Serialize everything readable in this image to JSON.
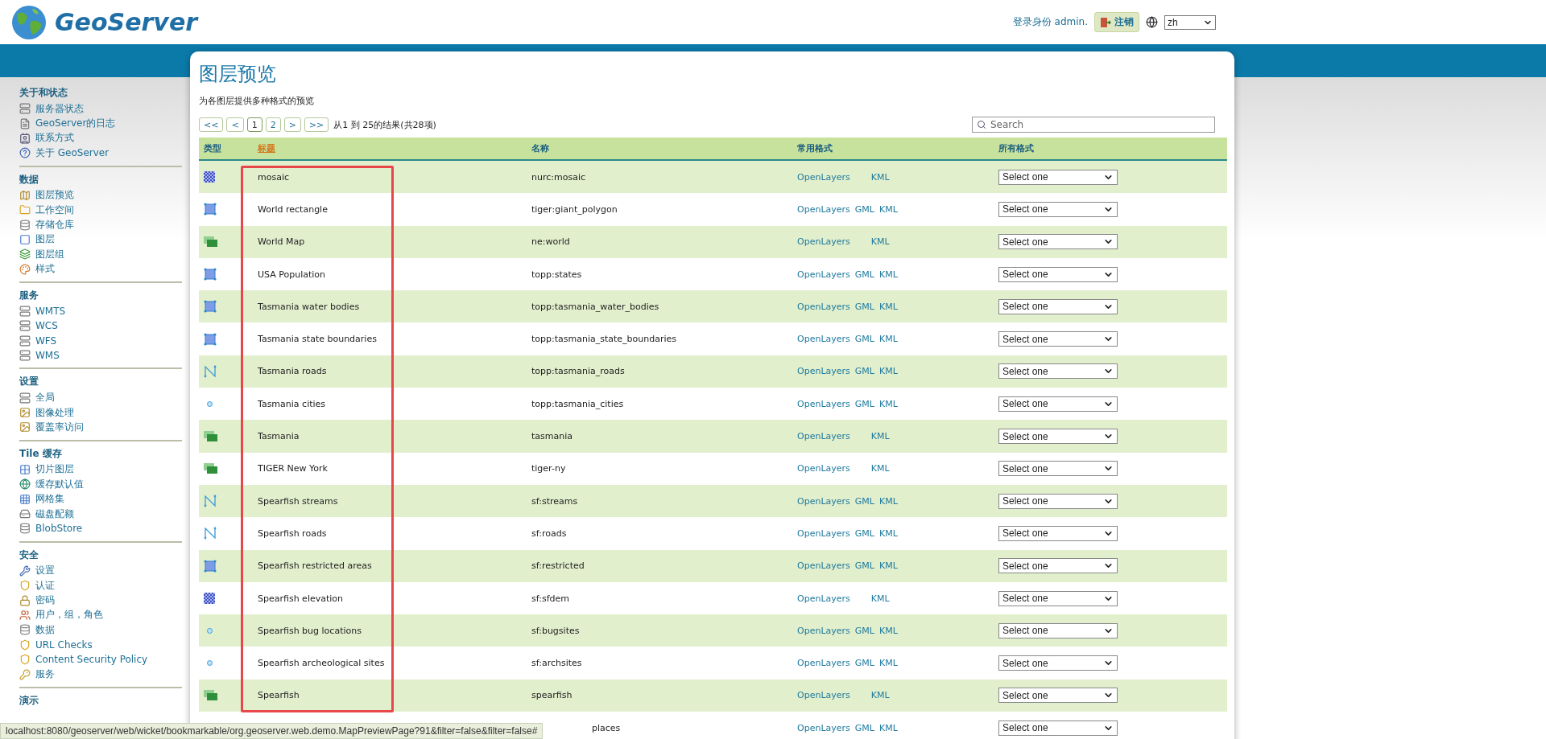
{
  "header": {
    "logo_text": "GeoServer",
    "login_text": "登录身份 admin.",
    "logout_button": "注销",
    "language": "zh"
  },
  "sidebar": [
    {
      "title": "关于和状态",
      "items": [
        "服务器状态",
        "GeoServer的日志",
        "联系方式",
        "关于 GeoServer"
      ]
    },
    {
      "title": "数据",
      "items": [
        "图层预览",
        "工作空间",
        "存储仓库",
        "图层",
        "图层组",
        "样式"
      ]
    },
    {
      "title": "服务",
      "items": [
        "WMTS",
        "WCS",
        "WFS",
        "WMS"
      ]
    },
    {
      "title": "设置",
      "items": [
        "全局",
        "图像处理",
        "覆盖率访问"
      ]
    },
    {
      "title": "Tile 缓存",
      "items": [
        "切片图层",
        "缓存默认值",
        "网格集",
        "磁盘配额",
        "BlobStore"
      ]
    },
    {
      "title": "安全",
      "items": [
        "设置",
        "认证",
        "密码",
        "用户，组，角色",
        "数据",
        "URL Checks",
        "Content Security Policy",
        "服务"
      ]
    },
    {
      "title": "演示"
    }
  ],
  "page": {
    "title": "图层预览",
    "description": "为各图层提供多种格式的预览"
  },
  "pager": {
    "buttons": [
      {
        "label": "<<",
        "selected": false
      },
      {
        "label": "<",
        "selected": false
      },
      {
        "label": "1",
        "selected": true
      },
      {
        "label": "2",
        "selected": false
      },
      {
        "label": ">",
        "selected": false
      },
      {
        "label": ">>",
        "selected": false
      }
    ],
    "summary": "从1 到 25的结果(共28项)"
  },
  "search": {
    "placeholder": "Search"
  },
  "table": {
    "columns": [
      {
        "label": "类型",
        "sorted": false
      },
      {
        "label": "标题",
        "sorted": true
      },
      {
        "label": "名称",
        "sorted": false
      },
      {
        "label": "常用格式",
        "sorted": false
      },
      {
        "label": "所有格式",
        "sorted": false
      }
    ],
    "rows": [
      {
        "kind": "raster",
        "title": "mosaic",
        "name": "nurc:mosaic",
        "formats": [
          "OpenLayers",
          "KML"
        ],
        "select": "Select one"
      },
      {
        "kind": "polygon",
        "title": "World rectangle",
        "name": "tiger:giant_polygon",
        "formats": [
          "OpenLayers",
          "GML",
          "KML"
        ],
        "select": "Select one"
      },
      {
        "kind": "group",
        "title": "World Map",
        "name": "ne:world",
        "formats": [
          "OpenLayers",
          "KML"
        ],
        "select": "Select one"
      },
      {
        "kind": "polygon",
        "title": "USA Population",
        "name": "topp:states",
        "formats": [
          "OpenLayers",
          "GML",
          "KML"
        ],
        "select": "Select one"
      },
      {
        "kind": "polygon",
        "title": "Tasmania water bodies",
        "name": "topp:tasmania_water_bodies",
        "formats": [
          "OpenLayers",
          "GML",
          "KML"
        ],
        "select": "Select one"
      },
      {
        "kind": "polygon",
        "title": "Tasmania state boundaries",
        "name": "topp:tasmania_state_boundaries",
        "formats": [
          "OpenLayers",
          "GML",
          "KML"
        ],
        "select": "Select one"
      },
      {
        "kind": "line",
        "title": "Tasmania roads",
        "name": "topp:tasmania_roads",
        "formats": [
          "OpenLayers",
          "GML",
          "KML"
        ],
        "select": "Select one"
      },
      {
        "kind": "point",
        "title": "Tasmania cities",
        "name": "topp:tasmania_cities",
        "formats": [
          "OpenLayers",
          "GML",
          "KML"
        ],
        "select": "Select one"
      },
      {
        "kind": "group",
        "title": "Tasmania",
        "name": "tasmania",
        "formats": [
          "OpenLayers",
          "KML"
        ],
        "select": "Select one"
      },
      {
        "kind": "group",
        "title": "TIGER New York",
        "name": "tiger-ny",
        "formats": [
          "OpenLayers",
          "KML"
        ],
        "select": "Select one"
      },
      {
        "kind": "line",
        "title": "Spearfish streams",
        "name": "sf:streams",
        "formats": [
          "OpenLayers",
          "GML",
          "KML"
        ],
        "select": "Select one"
      },
      {
        "kind": "line",
        "title": "Spearfish roads",
        "name": "sf:roads",
        "formats": [
          "OpenLayers",
          "GML",
          "KML"
        ],
        "select": "Select one"
      },
      {
        "kind": "polygon",
        "title": "Spearfish restricted areas",
        "name": "sf:restricted",
        "formats": [
          "OpenLayers",
          "GML",
          "KML"
        ],
        "select": "Select one"
      },
      {
        "kind": "raster",
        "title": "Spearfish elevation",
        "name": "sf:sfdem",
        "formats": [
          "OpenLayers",
          "KML"
        ],
        "select": "Select one"
      },
      {
        "kind": "point",
        "title": "Spearfish bug locations",
        "name": "sf:bugsites",
        "formats": [
          "OpenLayers",
          "GML",
          "KML"
        ],
        "select": "Select one"
      },
      {
        "kind": "point",
        "title": "Spearfish archeological sites",
        "name": "sf:archsites",
        "formats": [
          "OpenLayers",
          "GML",
          "KML"
        ],
        "select": "Select one"
      },
      {
        "kind": "group",
        "title": "Spearfish",
        "name": "spearfish",
        "formats": [
          "OpenLayers",
          "KML"
        ],
        "select": "Select one"
      },
      {
        "kind": "covered",
        "name": "places",
        "formats": [
          "OpenLayers",
          "GML",
          "KML"
        ],
        "select": "Select one"
      }
    ]
  },
  "annotation": {
    "kind": "frame"
  },
  "status_bar": "localhost:8080/geoserver/web/wicket/bookmarkable/org.geoserver.web.demo.MapPreviewPage?91&filter=false&filter=false#"
}
